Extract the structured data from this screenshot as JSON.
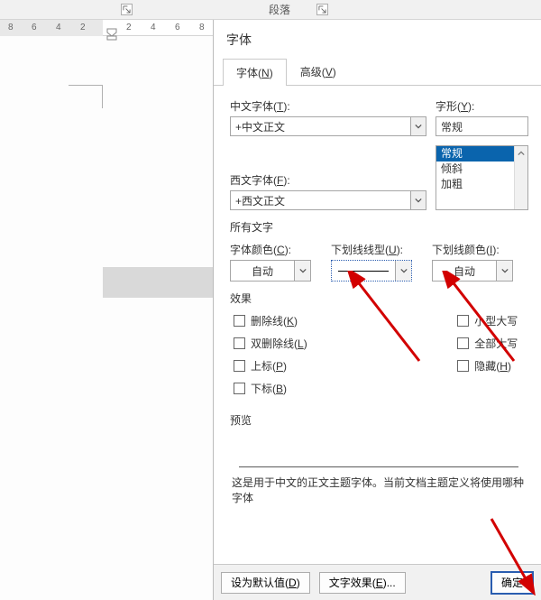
{
  "ribbon": {
    "group_paragraph": "段落"
  },
  "ruler": {
    "marks": [
      "8",
      "6",
      "4",
      "2",
      "2",
      "4",
      "6",
      "8"
    ]
  },
  "dialog": {
    "title": "字体",
    "tabs": {
      "font": "字体",
      "font_acc": "N",
      "adv": "高级",
      "adv_acc": "V"
    },
    "labels": {
      "chinese_font": "中文字体",
      "chinese_font_acc": "T",
      "western_font": "西文字体",
      "western_font_acc": "F",
      "style": "字形",
      "style_acc": "Y",
      "all_text": "所有文字",
      "font_color": "字体颜色",
      "font_color_acc": "C",
      "underline_style": "下划线线型",
      "underline_style_acc": "U",
      "underline_color": "下划线颜色",
      "underline_color_acc": "I",
      "effects": "效果",
      "preview": "预览"
    },
    "values": {
      "chinese_font": "+中文正文",
      "western_font": "+西文正文",
      "font_color": "自动",
      "underline_color": "自动"
    },
    "style_list": {
      "opt1": "常规",
      "opt2": "常规",
      "opt3": "倾斜",
      "opt4": "加粗"
    },
    "effects": {
      "strike": "删除线",
      "strike_acc": "K",
      "dstrike": "双删除线",
      "dstrike_acc": "L",
      "sup": "上标",
      "sup_acc": "P",
      "sub": "下标",
      "sub_acc": "B",
      "smallcaps": "小型大写",
      "smallcaps_acc": "",
      "allcaps": "全部大写",
      "allcaps_acc": "",
      "hidden": "隐藏",
      "hidden_acc": "H"
    },
    "desc": "这是用于中文的正文主题字体。当前文档主题定义将使用哪种字体",
    "buttons": {
      "default": "设为默认值",
      "default_acc": "D",
      "tfx": "文字效果",
      "tfx_acc": "E",
      "ok": "确定"
    }
  }
}
